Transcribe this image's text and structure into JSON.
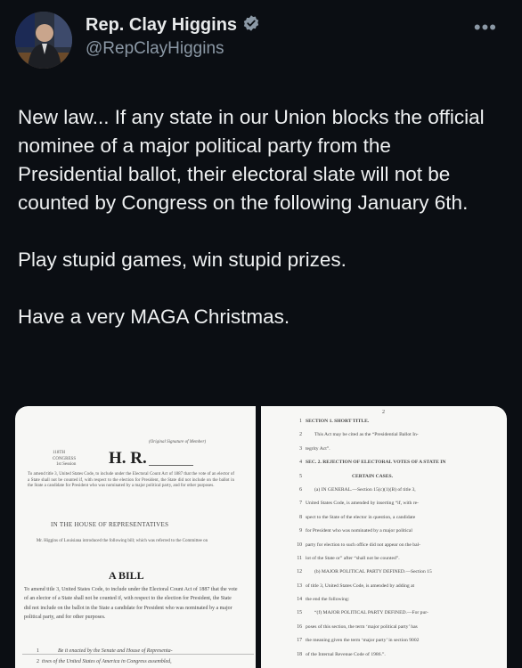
{
  "account": {
    "name": "Rep. Clay Higgins",
    "handle": "@RepClayHiggins",
    "verified_icon": "verified-badge-icon",
    "more_icon": "more-options-icon",
    "verified_color": "#8b98a5"
  },
  "tweet": {
    "para1": "New law... If any state in our Union blocks the official nominee of a major political party from the Presidential ballot, their electoral slate will not be counted by Congress on the following January 6th.",
    "para2": "Play stupid games, win stupid prizes.",
    "para3": "Have a very MAGA Christmas."
  },
  "bill_page1": {
    "original_signature": "(Original Signature of Member)",
    "congress": "118TH CONGRESS",
    "session": "1st Session",
    "bill_number": "H. R.",
    "summary": "To amend title 3, United States Code, to include under the Electoral Count Act of 1887 that the vote of an elector of a State shall not be counted if, with respect to the election for President, the State did not include on the ballot in the State a candidate for President who was nominated by a major political party, and for other purposes.",
    "house": "IN THE HOUSE OF REPRESENTATIVES",
    "introduced": "Mr. Higgins of Louisiana introduced the following bill; which was referred to the Committee on",
    "a_bill": "A BILL",
    "long_title": "To amend title 3, United States Code, to include under the Electoral Count Act of 1887 that the vote of an elector of a State shall not be counted if, with respect to the election for President, the State did not include on the ballot in the State a candidate for President who was nominated by a major political party, and for other purposes.",
    "line1": "Be it enacted by the Senate and House of Representa-",
    "line2": "tives of the United States of America in Congress assembled,"
  },
  "bill_page2": {
    "page_number": "2",
    "lines": [
      {
        "n": "1",
        "t": "SECTION 1. SHORT TITLE."
      },
      {
        "n": "2",
        "t": "This Act may be cited as the “Presidential Ballot In-"
      },
      {
        "n": "3",
        "t": "tegrity Act”."
      },
      {
        "n": "4",
        "t": "SEC. 2. REJECTION OF ELECTORAL VOTES OF A STATE IN"
      },
      {
        "n": "5",
        "t": "CERTAIN CASES."
      },
      {
        "n": "6",
        "t": "(a) IN GENERAL.—Section 15(c)(1)(B) of title 3,"
      },
      {
        "n": "7",
        "t": "United States Code, is amended by inserting “if, with re-"
      },
      {
        "n": "8",
        "t": "spect to the State of the elector in question, a candidate"
      },
      {
        "n": "9",
        "t": "for President who was nominated by a major political"
      },
      {
        "n": "10",
        "t": "party for election to such office did not appear on the bal-"
      },
      {
        "n": "11",
        "t": "lot of the State or” after “shall not be counted”."
      },
      {
        "n": "12",
        "t": "(b) MAJOR POLITICAL PARTY DEFINED.—Section 15"
      },
      {
        "n": "13",
        "t": "of title 3, United States Code, is amended by adding at"
      },
      {
        "n": "14",
        "t": "the end the following:"
      },
      {
        "n": "15",
        "t": "“(f) MAJOR POLITICAL PARTY DEFINED.—For pur-"
      },
      {
        "n": "16",
        "t": "poses of this section, the term ‘major political party’ has"
      },
      {
        "n": "17",
        "t": "the meaning given the term ‘major party’ in section 9002"
      },
      {
        "n": "18",
        "t": "of the Internal Revenue Code of 1986.”."
      }
    ]
  }
}
